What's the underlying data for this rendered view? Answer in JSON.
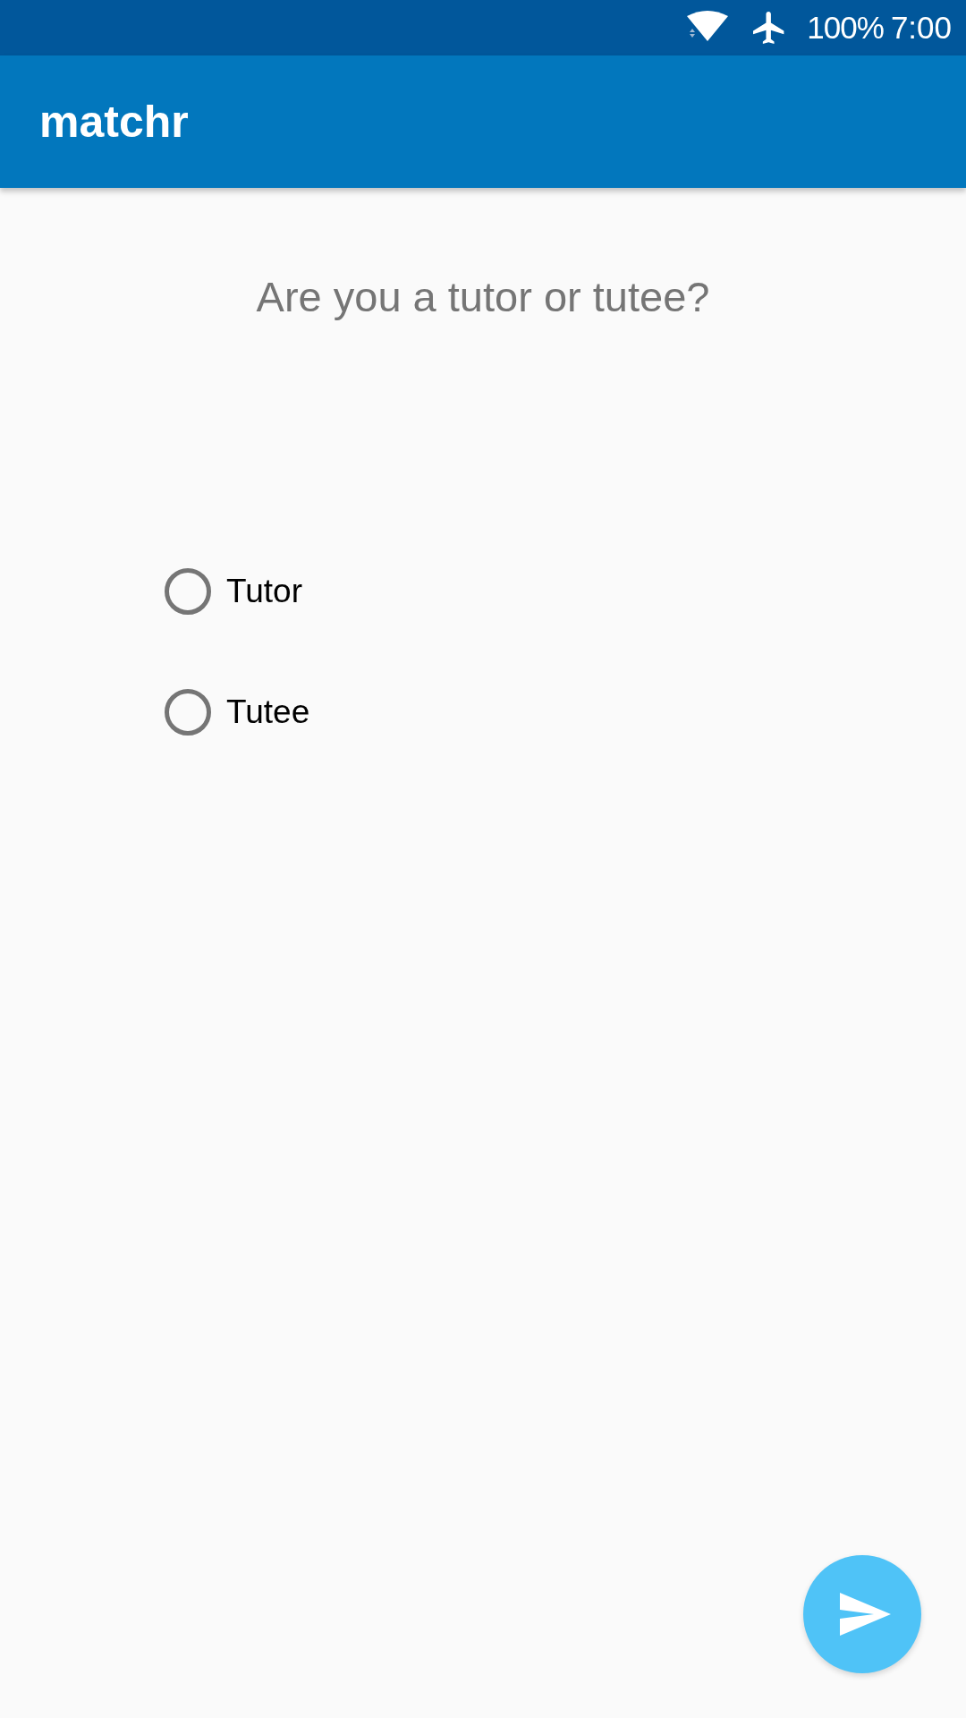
{
  "status_bar": {
    "battery": "100%",
    "time": "7:00"
  },
  "app_bar": {
    "title": "matchr"
  },
  "question": "Are you a tutor or tutee?",
  "options": [
    {
      "label": "Tutor",
      "selected": false
    },
    {
      "label": "Tutee",
      "selected": false
    }
  ]
}
